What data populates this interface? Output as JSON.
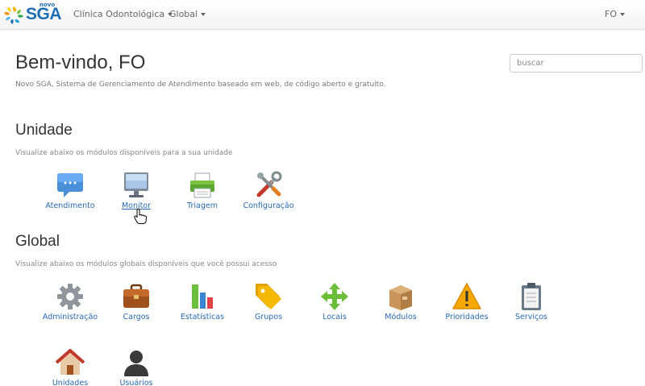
{
  "navbar": {
    "brand_prefix": "novo",
    "brand": "SGA",
    "menu_unit": "Clínica Odontológica",
    "menu_global": "Global",
    "menu_user": "FO"
  },
  "header": {
    "title": "Bem-vindo, FO",
    "subtitle": "Novo SGA, Sistema de Gerenciamento de Atendimento baseado em web, de código aberto e gratuito.",
    "search_placeholder": "buscar"
  },
  "unidade": {
    "title": "Unidade",
    "description": "Visualize abaixo os módulos disponíveis para a sua unidade",
    "modules": [
      {
        "label": "Atendimento",
        "icon": "chat-bubble-icon"
      },
      {
        "label": "Monitor",
        "icon": "monitor-icon"
      },
      {
        "label": "Triagem",
        "icon": "printer-icon"
      },
      {
        "label": "Configuração",
        "icon": "tools-icon"
      }
    ]
  },
  "global": {
    "title": "Global",
    "description": "Visualize abaixo os módulos globais disponíveis que você possui acesso",
    "modules": [
      {
        "label": "Administração",
        "icon": "gear-icon"
      },
      {
        "label": "Cargos",
        "icon": "briefcase-icon"
      },
      {
        "label": "Estatísticas",
        "icon": "bar-chart-icon"
      },
      {
        "label": "Grupos",
        "icon": "tags-icon"
      },
      {
        "label": "Locais",
        "icon": "move-arrows-icon"
      },
      {
        "label": "Módulos",
        "icon": "package-icon"
      },
      {
        "label": "Prioridades",
        "icon": "warning-icon"
      },
      {
        "label": "Serviços",
        "icon": "clipboard-icon"
      },
      {
        "label": "Unidades",
        "icon": "house-icon"
      },
      {
        "label": "Usuários",
        "icon": "user-icon"
      }
    ]
  },
  "colors": {
    "link": "#2a6ab1",
    "brand": "#1f6fb5"
  }
}
